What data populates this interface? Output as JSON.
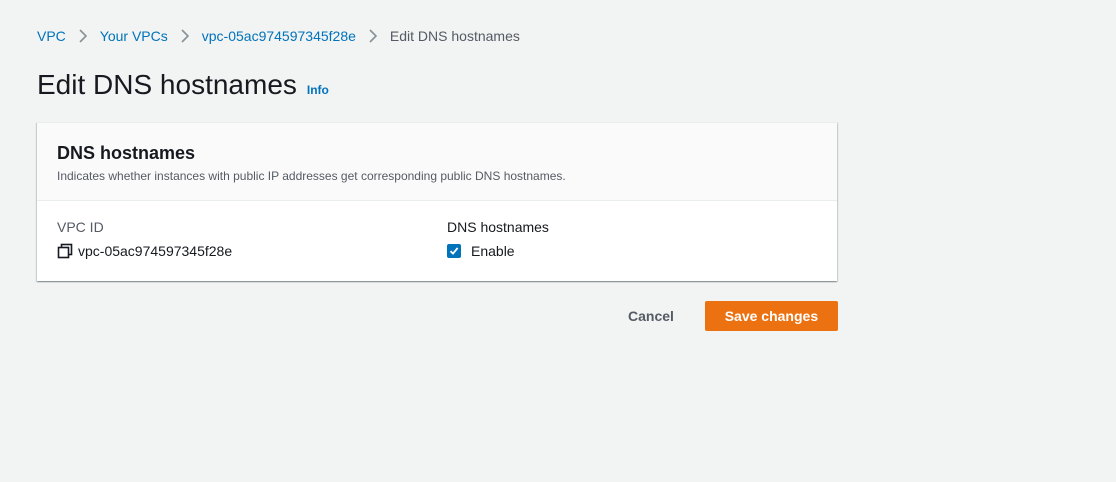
{
  "breadcrumb": {
    "items": [
      {
        "label": "VPC"
      },
      {
        "label": "Your VPCs"
      },
      {
        "label": "vpc-05ac974597345f28e"
      },
      {
        "label": "Edit DNS hostnames"
      }
    ]
  },
  "page": {
    "title": "Edit DNS hostnames",
    "info_label": "Info"
  },
  "panel": {
    "title": "DNS hostnames",
    "description": "Indicates whether instances with public IP addresses get corresponding public DNS hostnames.",
    "vpc_id_label": "VPC ID",
    "vpc_id_value": "vpc-05ac974597345f28e",
    "dns_label": "DNS hostnames",
    "enable_label": "Enable",
    "enable_checked": true
  },
  "actions": {
    "cancel_label": "Cancel",
    "save_label": "Save changes"
  },
  "colors": {
    "link": "#0073bb",
    "primary_button": "#ec7211",
    "checkbox": "#0073bb",
    "background": "#f2f3f3"
  },
  "icons": {
    "breadcrumb_separator": "chevron-right-icon",
    "copy": "copy-icon",
    "checkbox": "checkmark-icon"
  }
}
